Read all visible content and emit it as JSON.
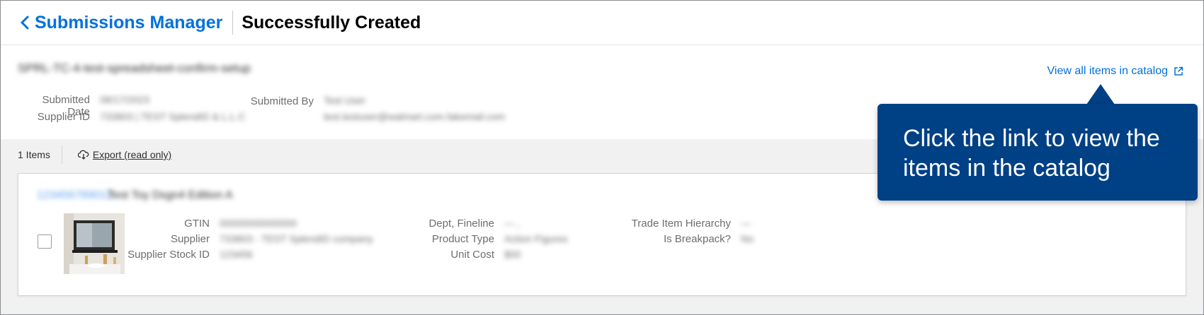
{
  "header": {
    "back_label": "Submissions Manager",
    "title": "Successfully Created"
  },
  "summary": {
    "submission_name": "SPRL-TC-4-test-spreadsheet-confirm-setup",
    "submitted_date_label": "Submitted Date",
    "submitted_date_value": "08/17/2023",
    "supplier_id_label": "Supplier ID",
    "supplier_id_value": "733803 | TEST SplendID & L.L.C",
    "submitted_by_label": "Submitted By",
    "submitted_by_name": "Test User",
    "submitted_by_email": "test.testuser@walmart.com.fakemail.com",
    "view_all_label": "View all items in catalog"
  },
  "items_bar": {
    "count_label": "1 Items",
    "export_label": "Export (read only)"
  },
  "item": {
    "id": "123456789012",
    "name": "Test Toy Dsgn4 Edition A",
    "fields": {
      "gtin_label": "GTIN",
      "gtin_value": "00000000000000",
      "supplier_label": "Supplier",
      "supplier_value": "733803 - TEST SplendID company",
      "stock_label": "Supplier Stock ID",
      "stock_value": "123456",
      "dept_label": "Dept, Fineline",
      "dept_value": "— ,",
      "ptype_label": "Product Type",
      "ptype_value": "Action Figures",
      "cost_label": "Unit Cost",
      "cost_value": "$00",
      "hierarchy_label": "Trade Item Hierarchy",
      "hierarchy_value": "—",
      "breakpack_label": "Is Breakpack?",
      "breakpack_value": "No"
    }
  },
  "tooltip": {
    "text": "Click the link to view the items in the catalog"
  },
  "colors": {
    "link": "#0071dc",
    "tooltip_bg": "#004085",
    "page_bg": "#f1f1f2"
  },
  "icons": {
    "back": "chevron-left-icon",
    "external": "external-link-icon",
    "export": "cloud-download-icon"
  }
}
